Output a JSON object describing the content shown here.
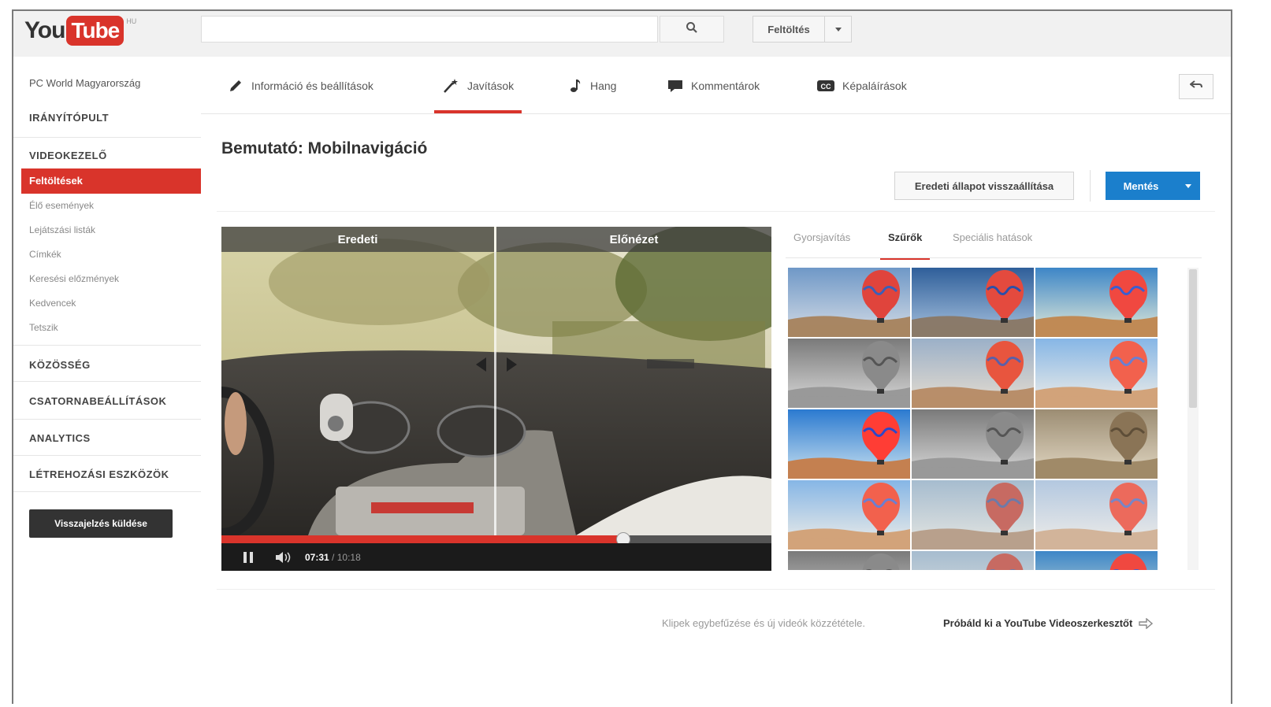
{
  "logo": {
    "you": "You",
    "tube": "Tube",
    "region": "HU"
  },
  "search": {
    "placeholder": ""
  },
  "header": {
    "upload_label": "Feltöltés"
  },
  "sidebar": {
    "channel_name": "PC World Magyarország",
    "dashboard": "IRÁNYÍTÓPULT",
    "video_manager": "VIDEOKEZELŐ",
    "items": [
      "Feltöltések",
      "Élő események",
      "Lejátszási listák",
      "Címkék",
      "Keresési előzmények",
      "Kedvencek",
      "Tetszik"
    ],
    "community": "KÖZÖSSÉG",
    "channel_settings": "CSATORNABEÁLLÍTÁSOK",
    "analytics": "ANALYTICS",
    "creation_tools": "LÉTREHOZÁSI ESZKÖZÖK",
    "feedback_button": "Visszajelzés küldése"
  },
  "tabs": [
    {
      "label": "Információ és beállítások",
      "icon": "pencil-icon"
    },
    {
      "label": "Javítások",
      "icon": "magic-wand-icon",
      "active": true
    },
    {
      "label": "Hang",
      "icon": "music-note-icon"
    },
    {
      "label": "Kommentárok",
      "icon": "speech-bubble-icon"
    },
    {
      "label": "Képaláírások",
      "icon": "cc-icon"
    }
  ],
  "page": {
    "title": "Bemutató: Mobilnavigáció"
  },
  "actions": {
    "revert_label": "Eredeti állapot visszaállítása",
    "save_label": "Mentés"
  },
  "video": {
    "original_label": "Eredeti",
    "preview_label": "Előnézet",
    "current_time": "07:31",
    "separator": " / ",
    "duration": "10:18",
    "progress_fraction": 0.73
  },
  "filter_tabs": [
    "Gyorsjavítás",
    "Szűrők",
    "Speciális hatások"
  ],
  "filters": {
    "active_tab": "Szűrők",
    "thumbnails": [
      "normal",
      "cool",
      "vivid",
      "grayscale",
      "warm",
      "bright",
      "saturated",
      "grayscale",
      "sepia",
      "bright",
      "faded",
      "soft",
      "grayscale",
      "faded",
      "vivid"
    ]
  },
  "footer": {
    "hint": "Klipek egybefűzése és új videók közzététele.",
    "editor_link": "Próbáld ki a YouTube Videoszerkesztőt"
  },
  "colors": {
    "accent_red": "#d9342b",
    "save_blue": "#1b7fcc"
  }
}
